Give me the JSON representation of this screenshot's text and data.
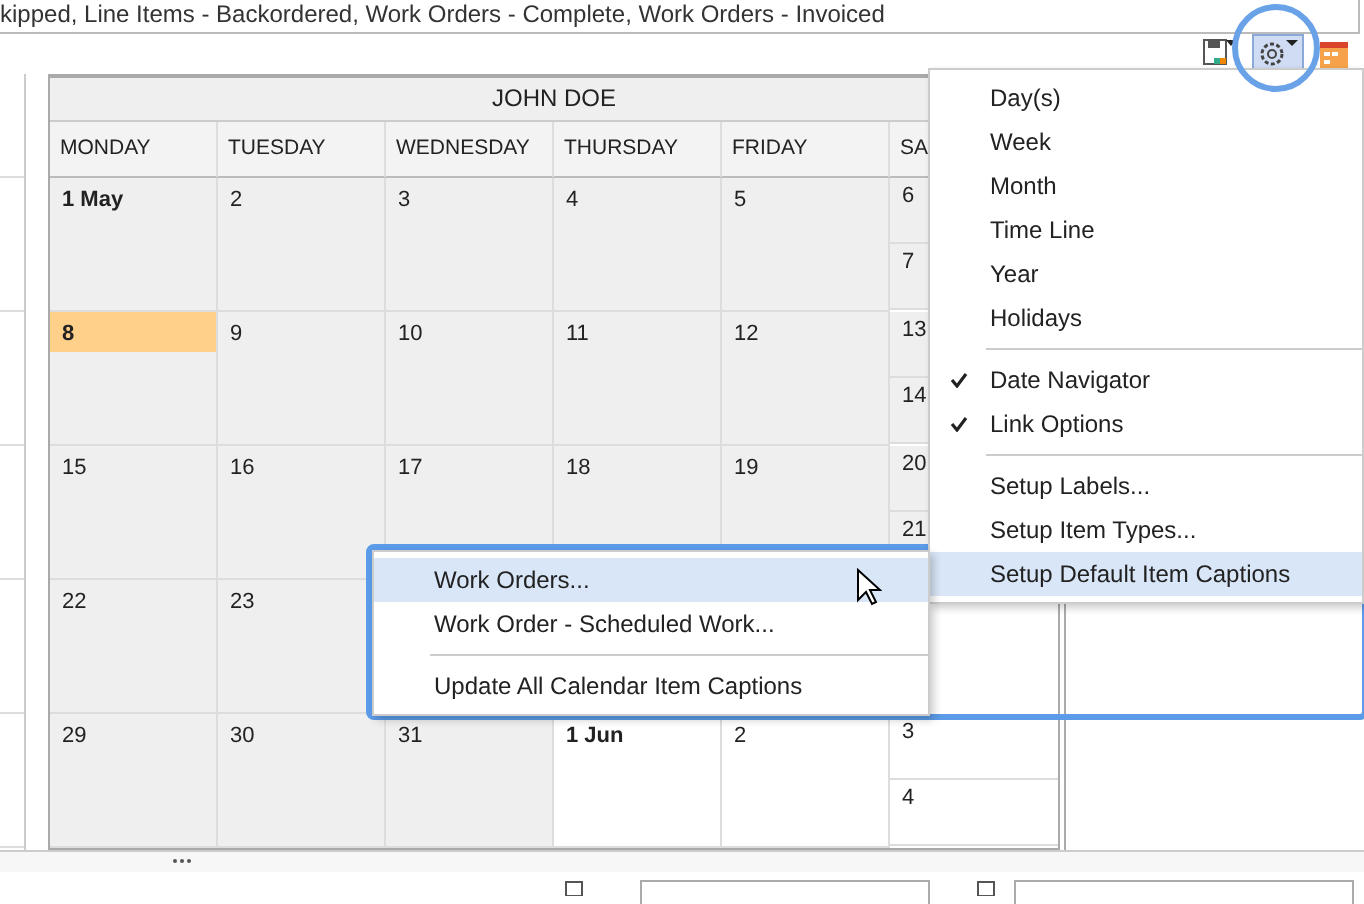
{
  "filter_text": "kipped, Line Items - Backordered, Work Orders - Complete, Work Orders - Invoiced",
  "toolbar": {
    "buttons": [
      {
        "kind": "save",
        "selected": false
      },
      {
        "kind": "settings",
        "selected": true
      },
      {
        "kind": "calendar",
        "selected": false
      }
    ]
  },
  "calendar": {
    "resource": "JOHN DOE",
    "days": [
      "MONDAY",
      "TUESDAY",
      "WEDNESDAY",
      "THURSDAY",
      "FRIDAY",
      "SA"
    ],
    "weeks": [
      {
        "days": [
          {
            "label": "1 May",
            "bold": true,
            "other_month": false,
            "today": false
          },
          {
            "label": "2",
            "bold": false,
            "other_month": false,
            "today": false
          },
          {
            "label": "3",
            "bold": false,
            "other_month": false,
            "today": false
          },
          {
            "label": "4",
            "bold": false,
            "other_month": false,
            "today": false
          },
          {
            "label": "5",
            "bold": false,
            "other_month": false,
            "today": false
          }
        ],
        "weekend": [
          {
            "label": "6",
            "other_month": false
          },
          {
            "label": "7",
            "other_month": false
          }
        ]
      },
      {
        "days": [
          {
            "label": "8",
            "bold": true,
            "other_month": false,
            "today": true
          },
          {
            "label": "9",
            "bold": false,
            "other_month": false,
            "today": false
          },
          {
            "label": "10",
            "bold": false,
            "other_month": false,
            "today": false
          },
          {
            "label": "11",
            "bold": false,
            "other_month": false,
            "today": false
          },
          {
            "label": "12",
            "bold": false,
            "other_month": false,
            "today": false
          }
        ],
        "weekend": [
          {
            "label": "13",
            "other_month": false
          },
          {
            "label": "14",
            "other_month": false
          }
        ]
      },
      {
        "days": [
          {
            "label": "15",
            "bold": false,
            "other_month": false,
            "today": false
          },
          {
            "label": "16",
            "bold": false,
            "other_month": false,
            "today": false
          },
          {
            "label": "17",
            "bold": false,
            "other_month": false,
            "today": false
          },
          {
            "label": "18",
            "bold": false,
            "other_month": false,
            "today": false
          },
          {
            "label": "19",
            "bold": false,
            "other_month": false,
            "today": false
          }
        ],
        "weekend": [
          {
            "label": "20",
            "other_month": false
          },
          {
            "label": "21",
            "other_month": false
          }
        ]
      },
      {
        "days": [
          {
            "label": "22",
            "bold": false,
            "other_month": false,
            "today": false
          },
          {
            "label": "23",
            "bold": false,
            "other_month": false,
            "today": false
          }
        ]
      },
      {
        "days": [
          {
            "label": "29",
            "bold": false,
            "other_month": false,
            "today": false
          },
          {
            "label": "30",
            "bold": false,
            "other_month": false,
            "today": false
          },
          {
            "label": "31",
            "bold": false,
            "other_month": false,
            "today": false
          },
          {
            "label": "1 Jun",
            "bold": true,
            "other_month": true,
            "today": false
          },
          {
            "label": "2",
            "bold": false,
            "other_month": true,
            "today": false
          }
        ],
        "weekend": [
          {
            "label": "3",
            "other_month": true
          },
          {
            "label": "4",
            "other_month": true
          }
        ]
      }
    ]
  },
  "main_menu": {
    "items": [
      {
        "kind": "item",
        "label": "Day(s)",
        "checked": false,
        "selected": false
      },
      {
        "kind": "item",
        "label": "Week",
        "checked": false,
        "selected": false
      },
      {
        "kind": "item",
        "label": "Month",
        "checked": false,
        "selected": false
      },
      {
        "kind": "item",
        "label": "Time Line",
        "checked": false,
        "selected": false
      },
      {
        "kind": "item",
        "label": "Year",
        "checked": false,
        "selected": false
      },
      {
        "kind": "item",
        "label": "Holidays",
        "checked": false,
        "selected": false
      },
      {
        "kind": "separator"
      },
      {
        "kind": "item",
        "label": "Date Navigator",
        "checked": true,
        "selected": false
      },
      {
        "kind": "item",
        "label": "Link Options",
        "checked": true,
        "selected": false
      },
      {
        "kind": "separator"
      },
      {
        "kind": "item",
        "label": "Setup Labels...",
        "checked": false,
        "selected": false
      },
      {
        "kind": "item",
        "label": "Setup Item Types...",
        "checked": false,
        "selected": false
      },
      {
        "kind": "item",
        "label": "Setup Default Item Captions",
        "checked": false,
        "selected": true
      }
    ]
  },
  "submenu": {
    "items": [
      {
        "kind": "item",
        "label": "Work Orders...",
        "selected": true
      },
      {
        "kind": "item",
        "label": "Work Order - Scheduled Work...",
        "selected": false
      },
      {
        "kind": "separator"
      },
      {
        "kind": "item",
        "label": "Update All Calendar Item Captions",
        "selected": false
      }
    ]
  }
}
